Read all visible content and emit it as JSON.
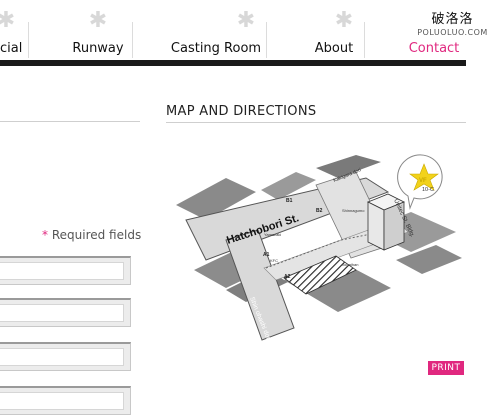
{
  "nav": {
    "items": [
      {
        "label": "cial"
      },
      {
        "label": "Runway"
      },
      {
        "label": "Casting Room"
      },
      {
        "label": "About"
      },
      {
        "label": "Contact"
      }
    ],
    "active_color": "#e0287f"
  },
  "watermark": {
    "cn": "破洛洛",
    "url": "POLUOLUO.COM"
  },
  "form": {
    "required_note": "Required fields",
    "required_mark": "*"
  },
  "map_section": {
    "title": "MAP AND DIRECTIONS",
    "print_label": "PRINT",
    "map": {
      "main_street": "Hatchobori St.",
      "side_street": "Shin ohashi dori",
      "upper_road": "Kakigara dori",
      "building": "Unitec St. Bldg.",
      "badge": "10-C",
      "badge_logo": "VF",
      "marks": [
        "B1",
        "B2",
        "A1",
        "A2"
      ],
      "labels": [
        "Yamazaki",
        "KFC",
        "Shinnagumo",
        "Jonathan"
      ]
    }
  }
}
